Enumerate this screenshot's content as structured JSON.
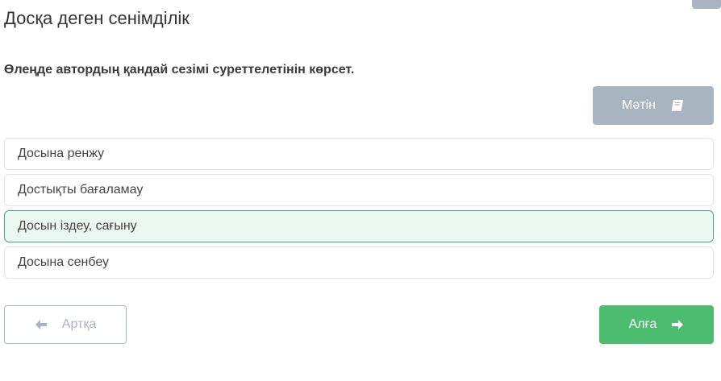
{
  "header": {
    "title": "Досқа деген сенімділік"
  },
  "question": {
    "text": "Өлеңде автордың қандай сезімі суреттелетінін көрсет."
  },
  "text_button": {
    "label": "Мәтін",
    "icon": "book-icon"
  },
  "options": [
    {
      "label": "Досына ренжу",
      "selected": false
    },
    {
      "label": "Достықты бағаламау",
      "selected": false
    },
    {
      "label": "Досын іздеу, сағыну",
      "selected": true
    },
    {
      "label": "Досына сенбеу",
      "selected": false
    }
  ],
  "navigation": {
    "back_label": "Артқа",
    "back_icon": "arrow-left-icon",
    "next_label": "Алға",
    "next_icon": "arrow-right-icon"
  },
  "colors": {
    "accent_green": "#4cbc6e",
    "selected_bg": "#ebf7f1",
    "selected_border": "#4ea385",
    "muted_button": "#a8b4c0"
  }
}
